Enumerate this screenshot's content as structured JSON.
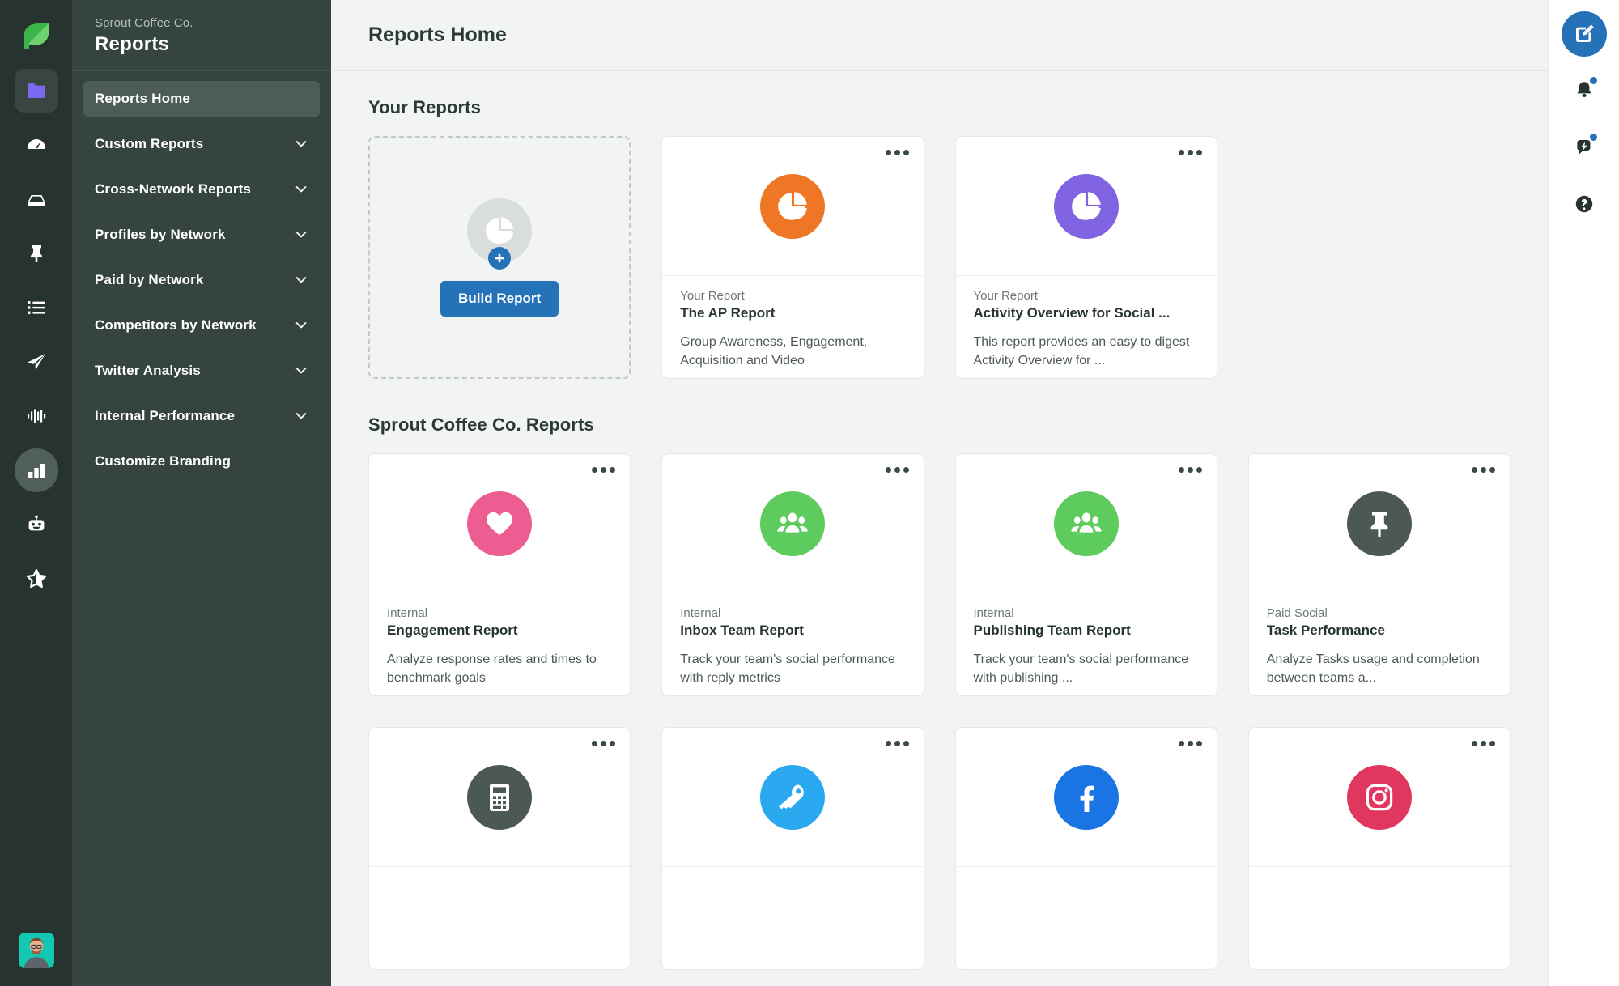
{
  "rail": {
    "logo_icon": "sprout-leaf-logo",
    "items": [
      {
        "icon": "folder-icon",
        "name": "assets",
        "state": "boxed"
      },
      {
        "icon": "speedometer-icon",
        "name": "dashboard",
        "state": "plain"
      },
      {
        "icon": "inbox-icon",
        "name": "smart-inbox",
        "state": "plain"
      },
      {
        "icon": "pin-icon",
        "name": "pinned",
        "state": "plain"
      },
      {
        "icon": "list-icon",
        "name": "tasks",
        "state": "plain"
      },
      {
        "icon": "paper-plane-icon",
        "name": "publishing",
        "state": "plain"
      },
      {
        "icon": "audio-wave-icon",
        "name": "listening",
        "state": "plain"
      },
      {
        "icon": "bar-chart-icon",
        "name": "reports",
        "state": "active"
      },
      {
        "icon": "robot-icon",
        "name": "bots",
        "state": "plain"
      },
      {
        "icon": "star-icon",
        "name": "reviews",
        "state": "plain"
      }
    ],
    "avatar_name": "user-avatar"
  },
  "sidebar": {
    "org": "Sprout Coffee Co.",
    "title": "Reports",
    "items": [
      {
        "label": "Reports Home",
        "expandable": false,
        "selected": true
      },
      {
        "label": "Custom Reports",
        "expandable": true,
        "selected": false
      },
      {
        "label": "Cross-Network Reports",
        "expandable": true,
        "selected": false
      },
      {
        "label": "Profiles by Network",
        "expandable": true,
        "selected": false
      },
      {
        "label": "Paid by Network",
        "expandable": true,
        "selected": false
      },
      {
        "label": "Competitors by Network",
        "expandable": true,
        "selected": false
      },
      {
        "label": "Twitter Analysis",
        "expandable": true,
        "selected": false
      },
      {
        "label": "Internal Performance",
        "expandable": true,
        "selected": false
      },
      {
        "label": "Customize Branding",
        "expandable": false,
        "selected": false
      }
    ]
  },
  "header": {
    "title": "Reports Home"
  },
  "your_reports": {
    "section_title": "Your Reports",
    "build": {
      "button_label": "Build Report",
      "icon": "pie-chart-icon",
      "plus_icon": "plus-icon"
    },
    "cards": [
      {
        "kicker": "Your Report",
        "name": "The AP Report",
        "desc": "Group Awareness, Engagement, Acquisition and Video",
        "icon": "pie-chart-icon",
        "color": "#ee7624"
      },
      {
        "kicker": "Your Report",
        "name": "Activity Overview for Social ...",
        "desc": "This report provides an easy to digest Activity Overview for ...",
        "icon": "pie-chart-icon",
        "color": "#7f63e0"
      }
    ]
  },
  "org_reports": {
    "section_title": "Sprout Coffee Co. Reports",
    "cards": [
      {
        "kicker": "Internal",
        "name": "Engagement Report",
        "desc": "Analyze response rates and times to benchmark goals",
        "icon": "heart-icon",
        "color": "#ec5e91"
      },
      {
        "kicker": "Internal",
        "name": "Inbox Team Report",
        "desc": "Track your team's social performance with reply metrics",
        "icon": "group-icon",
        "color": "#5ecb5e"
      },
      {
        "kicker": "Internal",
        "name": "Publishing Team Report",
        "desc": "Track your team's social performance with publishing ...",
        "icon": "group-icon",
        "color": "#5ecb5e"
      },
      {
        "kicker": "Paid Social",
        "name": "Task Performance",
        "desc": "Analyze Tasks usage and completion between teams a...",
        "icon": "pin-icon",
        "color": "#4b5855"
      },
      {
        "kicker": "",
        "name": "",
        "desc": "",
        "icon": "calculator-icon",
        "color": "#4b5855"
      },
      {
        "kicker": "",
        "name": "",
        "desc": "",
        "icon": "key-icon",
        "color": "#2aa9f0"
      },
      {
        "kicker": "",
        "name": "",
        "desc": "",
        "icon": "facebook-icon",
        "color": "#1b74e4"
      },
      {
        "kicker": "",
        "name": "",
        "desc": "",
        "icon": "instagram-icon",
        "color": "#e1365e"
      }
    ],
    "menu_icon": "more-options-icon"
  },
  "rightbar": {
    "items": [
      {
        "icon": "compose-icon",
        "name": "compose-button",
        "badge": false
      },
      {
        "icon": "bell-icon",
        "name": "notifications-button",
        "badge": true
      },
      {
        "icon": "megaphone-icon",
        "name": "whats-new-button",
        "badge": true
      },
      {
        "icon": "help-icon",
        "name": "help-button",
        "badge": false
      }
    ]
  },
  "colors": {
    "accent_blue": "#2572b8",
    "rail_bg": "#26332f",
    "nav_bg": "#36443f",
    "page_bg": "#f2f4f4"
  }
}
